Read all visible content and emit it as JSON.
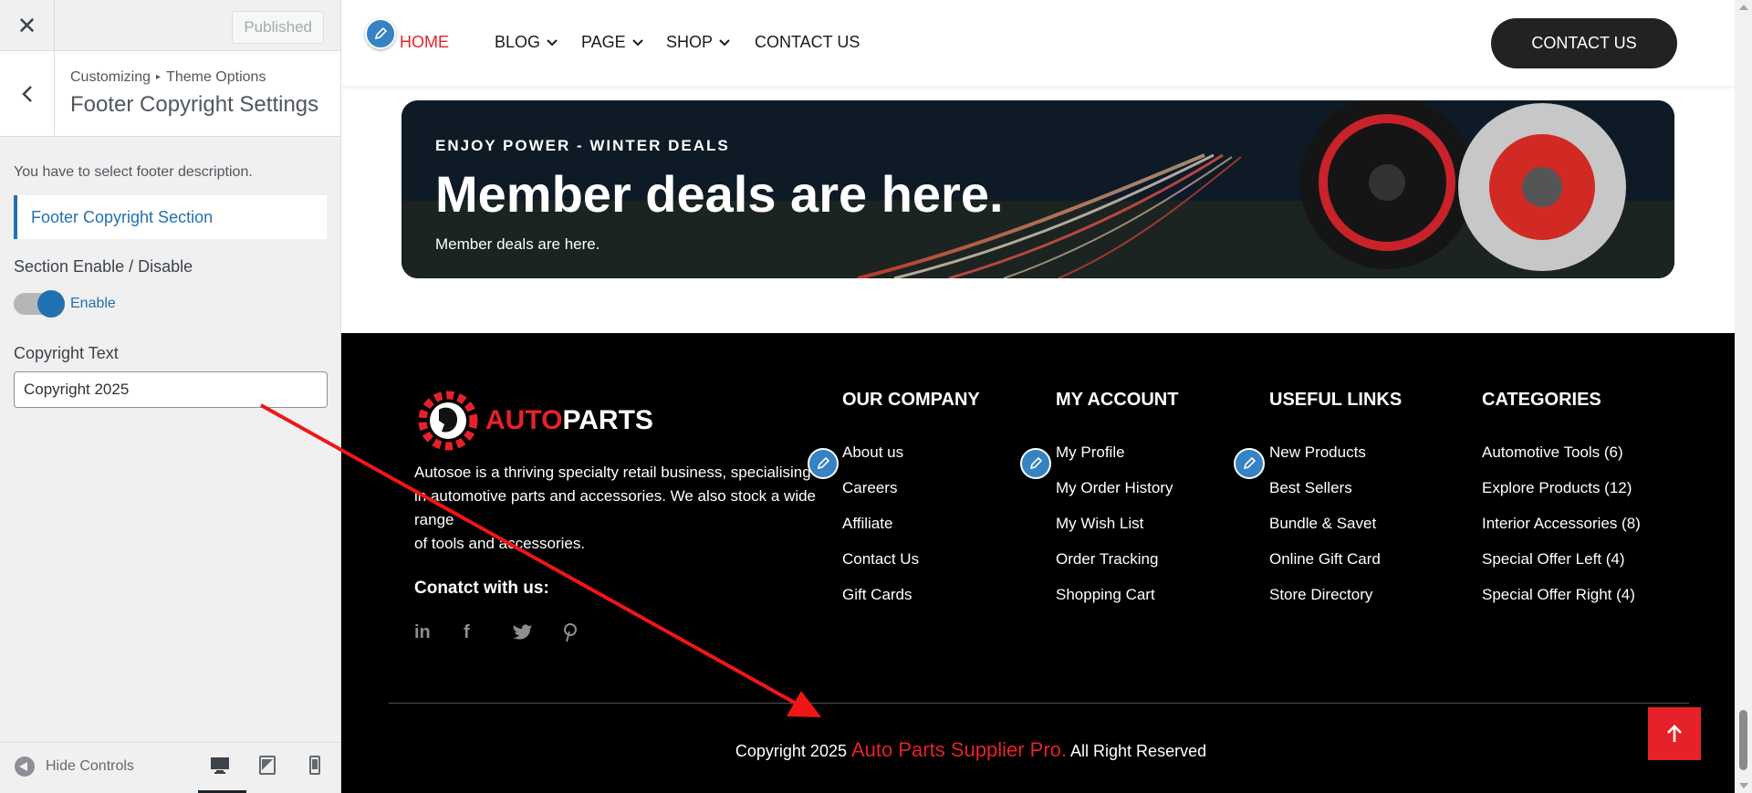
{
  "customizer": {
    "close_icon": "close-icon",
    "publish_label": "Published",
    "breadcrumb": {
      "root": "Customizing",
      "parent": "Theme Options"
    },
    "panel_title": "Footer Copyright Settings",
    "description": "You have to select footer description.",
    "section_heading": "Footer Copyright Section",
    "enable_label": "Section Enable / Disable",
    "toggle_state": "on",
    "toggle_text": "Enable",
    "copyright_label": "Copyright Text",
    "copyright_value": "Copyright 2025",
    "hide_controls": "Hide Controls",
    "accent_color": "#2271b1"
  },
  "site": {
    "nav": {
      "items": [
        {
          "label": "HOME",
          "active": true
        },
        {
          "label": "BLOG",
          "dropdown": true
        },
        {
          "label": "PAGE",
          "dropdown": true
        },
        {
          "label": "SHOP",
          "dropdown": true
        },
        {
          "label": "CONTACT US"
        }
      ],
      "cta": "CONTACT US"
    },
    "banner": {
      "kicker": "ENJOY POWER - WINTER DEALS",
      "title": "Member deals are here.",
      "subtitle": "Member deals are here."
    },
    "footer": {
      "logo_red": "AUTO",
      "logo_white": "PARTS",
      "about_line1": "Autosoe is a thriving specialty retail business, specialising in automotive parts and accessories. We also stock a wide range",
      "about_line2": "of tools and accessories.",
      "connect": "Conatct with us:",
      "columns": [
        {
          "title": "OUR COMPANY",
          "links": [
            "About us",
            "Careers",
            "Affiliate",
            "Contact Us",
            "Gift Cards"
          ]
        },
        {
          "title": "MY ACCOUNT",
          "links": [
            "My Profile",
            "My Order History",
            "My Wish List",
            "Order Tracking",
            "Shopping Cart"
          ]
        },
        {
          "title": "USEFUL LINKS",
          "links": [
            "New Products",
            "Best Sellers",
            "Bundle & Savet",
            "Online Gift Card",
            "Store Directory"
          ]
        },
        {
          "title": "CATEGORIES",
          "links": [
            "Automotive Tools (6)",
            "Explore Products (12)",
            "Interior Accessories (8)",
            "Special Offer Left (4)",
            "Special Offer Right (4)"
          ]
        }
      ],
      "copyright_prefix": "Copyright 2025",
      "copyright_brand": "Auto Parts Supplier Pro.",
      "copyright_suffix": "All Right Reserved",
      "brand_color": "#e52229"
    }
  }
}
